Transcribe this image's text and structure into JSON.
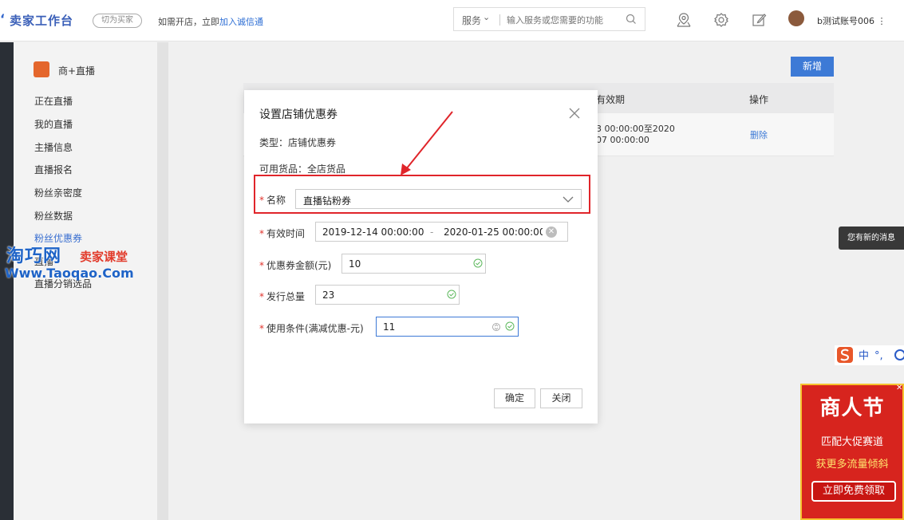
{
  "topbar": {
    "brand": "卖家工作台",
    "switch_label": "切为买家",
    "promo_prefix": "如需开店，立即",
    "promo_link": "加入诚信通",
    "search_scope": "服务",
    "search_placeholder": "输入服务或您需要的功能",
    "account": "b测试账号006 ⋮"
  },
  "sidebar": {
    "section_title": "商+直播",
    "items": [
      {
        "label": "正在直播"
      },
      {
        "label": "我的直播"
      },
      {
        "label": "主播信息"
      },
      {
        "label": "直播报名"
      },
      {
        "label": "粉丝亲密度"
      },
      {
        "label": "粉丝数据"
      },
      {
        "label": "粉丝优惠券"
      },
      {
        "label": "直播"
      },
      {
        "label": "直播分销选品"
      }
    ]
  },
  "watermark": {
    "line1": "淘巧网",
    "line1b": "卖家课堂",
    "line2": "Www.Taoqao.Com"
  },
  "main": {
    "add_button": "新增",
    "columns": {
      "validity": "有效期",
      "actions": "操作"
    },
    "row": {
      "validity_line1": "3 00:00:00至2020",
      "validity_line2": "07 00:00:00",
      "delete": "删除"
    }
  },
  "modal": {
    "title": "设置店铺优惠券",
    "type_text": "类型：店铺优惠券",
    "goods_text": "可用货品：全店货品",
    "name_label": "名称",
    "name_value": "直播钻粉券",
    "valid_label": "有效时间",
    "date_start": "2019-12-14 00:00:00",
    "date_sep": "-",
    "date_end": "2020-01-25 00:00:00",
    "amount_label": "优惠券金额(元)",
    "amount_value": "10",
    "total_label": "发行总量",
    "total_value": "23",
    "cond_label": "使用条件(满减优惠-元)",
    "cond_value": "11",
    "confirm": "确定",
    "close": "关闭"
  },
  "toast": "您有新的消息",
  "ad": {
    "title": "商人节",
    "line1": "匹配大促赛道",
    "line2": "获更多流量倾斜",
    "button": "立即免费领取"
  },
  "colors": {
    "accent": "#3d7ad6",
    "highlight": "#e0252a",
    "ad_red": "#d7241e"
  }
}
